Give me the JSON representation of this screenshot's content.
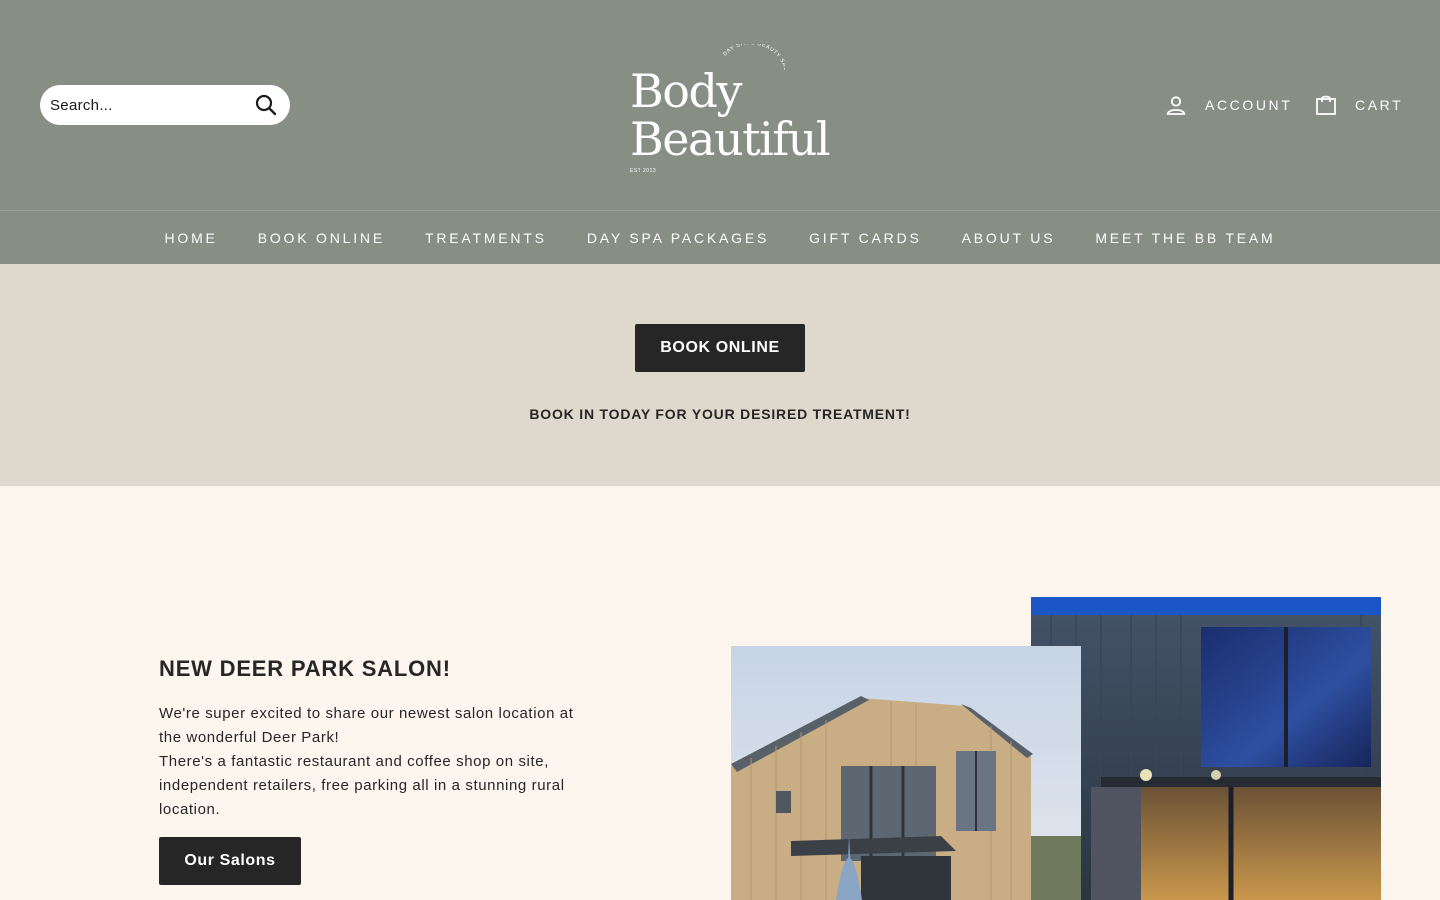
{
  "header": {
    "search_placeholder": "Search...",
    "logo": {
      "line1": "Body",
      "line2": "Beautiful",
      "tagline": "DAY SPA & BEAUTY SALON",
      "est": "EST 2013"
    },
    "account_label": "ACCOUNT",
    "cart_label": "CART"
  },
  "nav": {
    "items": [
      {
        "label": "HOME"
      },
      {
        "label": "BOOK ONLINE"
      },
      {
        "label": "TREATMENTS"
      },
      {
        "label": "DAY SPA PACKAGES"
      },
      {
        "label": "GIFT CARDS"
      },
      {
        "label": "ABOUT US"
      },
      {
        "label": "MEET THE BB TEAM"
      }
    ]
  },
  "booking": {
    "button_label": "BOOK ONLINE",
    "subtitle": "BOOK IN TODAY FOR YOUR DESIRED TREATMENT!"
  },
  "feature": {
    "title": "NEW DEER PARK SALON!",
    "line1": "We're super excited to share our newest salon location at the wonderful Deer Park!",
    "line2": "There's a fantastic restaurant and coffee shop on site, independent retailers, free parking all in a stunning rural location.",
    "button_label": "Our Salons"
  },
  "colors": {
    "header_bg": "#878e84",
    "band_bg": "#dfd8cc",
    "page_bg": "#fdf6ef",
    "button_bg": "#262626"
  },
  "icons": {
    "search": "search-icon",
    "account": "user-icon",
    "cart": "shopping-bag-icon"
  }
}
